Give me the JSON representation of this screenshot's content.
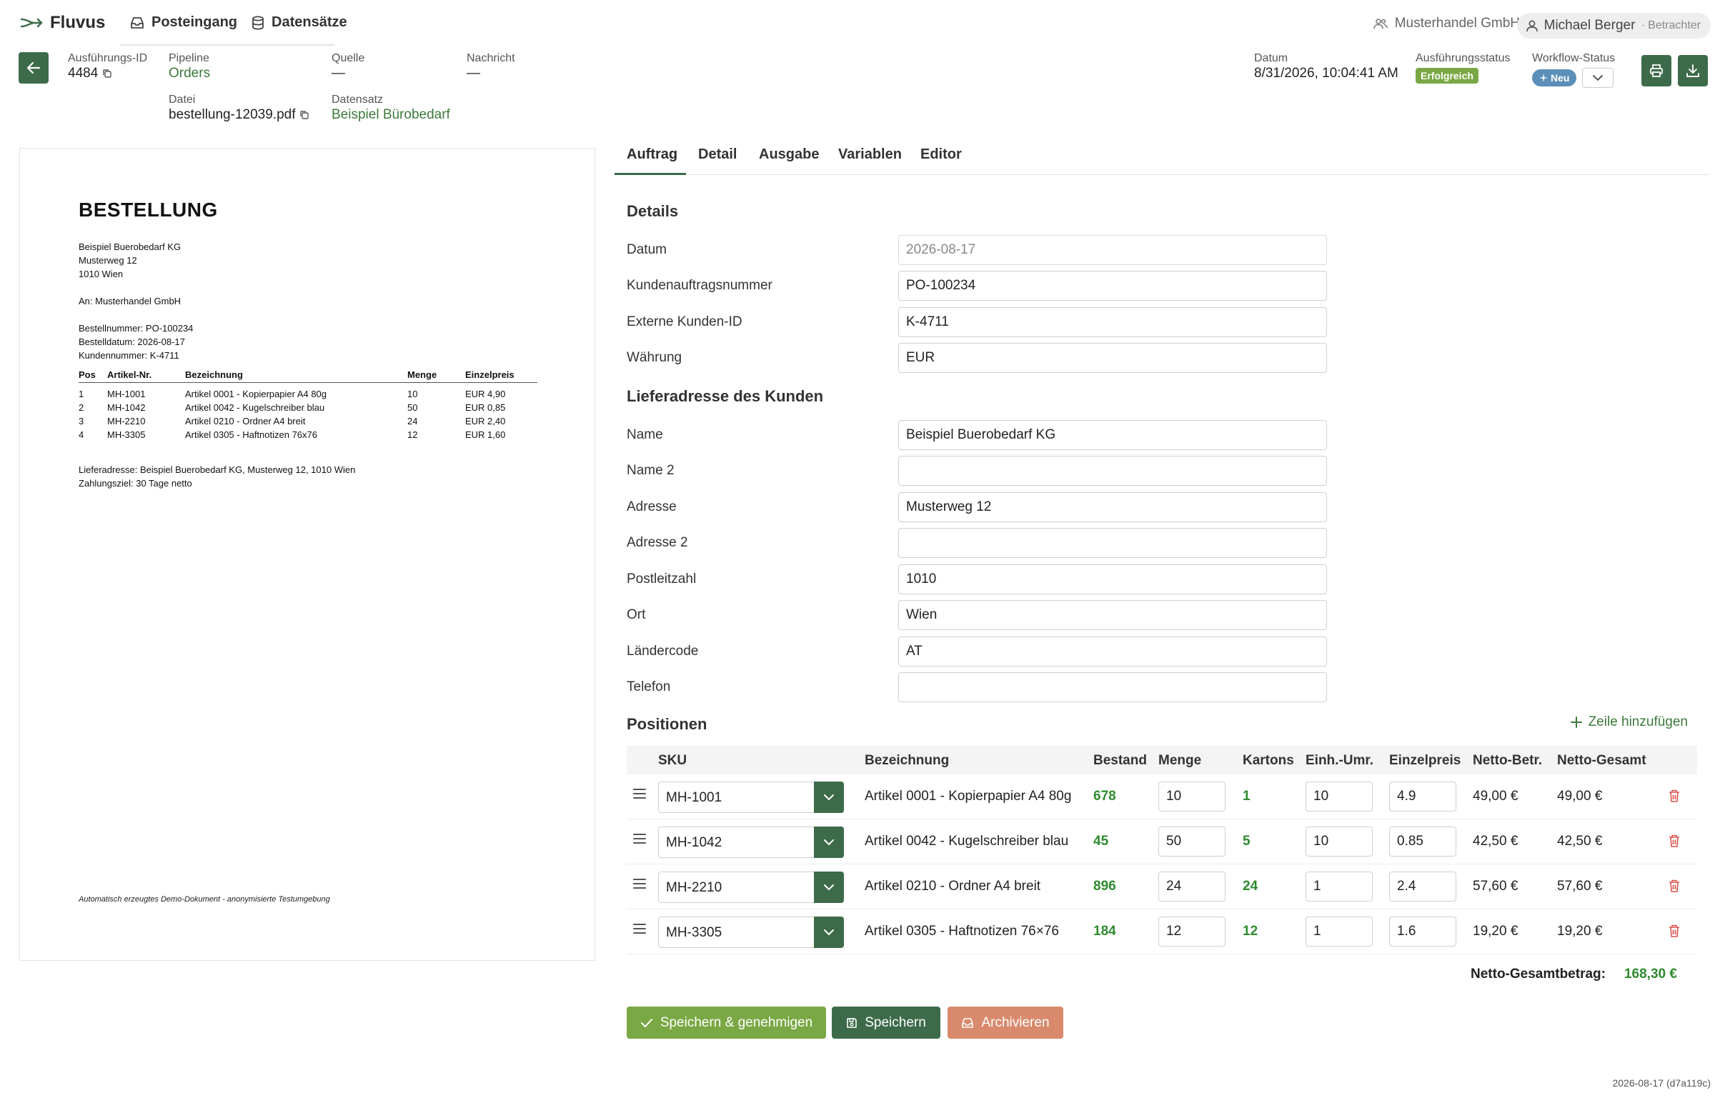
{
  "app": {
    "name": "Fluvus"
  },
  "nav": {
    "inbox": "Posteingang",
    "datasets": "Datensätze"
  },
  "account": {
    "company": "Musterhandel GmbH",
    "user": "Michael Berger",
    "role": "· Betrachter"
  },
  "meta": {
    "run_id_label": "Ausführungs-ID",
    "run_id": "4484",
    "pipeline_label": "Pipeline",
    "pipeline": "Orders",
    "source_label": "Quelle",
    "source": "—",
    "message_label": "Nachricht",
    "message": "—",
    "file_label": "Datei",
    "file": "bestellung-12039.pdf",
    "dataset_label": "Datensatz",
    "dataset": "Beispiel Bürobedarf",
    "date_label": "Datum",
    "date": "8/31/2026, 10:04:41 AM",
    "exec_status_label": "Ausführungsstatus",
    "exec_status": "Erfolgreich",
    "workflow_label": "Workflow-Status",
    "workflow": "Neu"
  },
  "document": {
    "title": "BESTELLUNG",
    "sender": [
      "Beispiel Buerobedarf KG",
      "Musterweg 12",
      "1010 Wien"
    ],
    "recipient": "An: Musterhandel GmbH",
    "order_info": [
      "Bestellnummer: PO-100234",
      "Bestelldatum: 2026-08-17",
      "Kundennummer: K-4711"
    ],
    "columns": [
      "Pos",
      "Artikel-Nr.",
      "Bezeichnung",
      "Menge",
      "Einzelpreis"
    ],
    "rows": [
      [
        "1",
        "MH-1001",
        "Artikel 0001 - Kopierpapier A4 80g",
        "10",
        "EUR 4,90"
      ],
      [
        "2",
        "MH-1042",
        "Artikel 0042 - Kugelschreiber blau",
        "50",
        "EUR 0,85"
      ],
      [
        "3",
        "MH-2210",
        "Artikel 0210 - Ordner A4 breit",
        "24",
        "EUR 2,40"
      ],
      [
        "4",
        "MH-3305",
        "Artikel 0305 - Haftnotizen 76x76",
        "12",
        "EUR 1,60"
      ]
    ],
    "delivery": "Lieferadresse: Beispiel Buerobedarf KG, Musterweg 12, 1010 Wien",
    "payment": "Zahlungsziel: 30 Tage netto",
    "footer": "Automatisch erzeugtes Demo-Dokument - anonymisierte Testumgebung"
  },
  "tabs": [
    "Auftrag",
    "Detail",
    "Ausgabe",
    "Variablen",
    "Editor"
  ],
  "details": {
    "heading": "Details",
    "fields": [
      {
        "label": "Datum",
        "value": "2026-08-17"
      },
      {
        "label": "Kundenauftragsnummer",
        "value": "PO-100234"
      },
      {
        "label": "Externe Kunden-ID",
        "value": "K-4711"
      },
      {
        "label": "Währung",
        "value": "EUR"
      }
    ]
  },
  "address": {
    "heading": "Lieferadresse des Kunden",
    "fields": [
      {
        "label": "Name",
        "value": "Beispiel Buerobedarf KG"
      },
      {
        "label": "Name 2",
        "value": ""
      },
      {
        "label": "Adresse",
        "value": "Musterweg 12"
      },
      {
        "label": "Adresse 2",
        "value": ""
      },
      {
        "label": "Postleitzahl",
        "value": "1010"
      },
      {
        "label": "Ort",
        "value": "Wien"
      },
      {
        "label": "Ländercode",
        "value": "AT"
      },
      {
        "label": "Telefon",
        "value": ""
      }
    ]
  },
  "positions": {
    "heading": "Positionen",
    "add_label": "Zeile hinzufügen",
    "columns": [
      "SKU",
      "Bezeichnung",
      "Bestand",
      "Menge",
      "Kartons",
      "Einh.-Umr.",
      "Einzelpreis",
      "Netto-Betr.",
      "Netto-Gesamt"
    ],
    "rows": [
      {
        "sku": "MH-1001",
        "desc": "Artikel 0001 - Kopierpapier A4 80g",
        "stock": "678",
        "qty": "10",
        "cartons": "1",
        "conv": "10",
        "price": "4.9",
        "net": "49,00 €",
        "net_total": "49,00 €"
      },
      {
        "sku": "MH-1042",
        "desc": "Artikel 0042 - Kugelschreiber blau",
        "stock": "45",
        "qty": "50",
        "cartons": "5",
        "conv": "10",
        "price": "0.85",
        "net": "42,50 €",
        "net_total": "42,50 €"
      },
      {
        "sku": "MH-2210",
        "desc": "Artikel 0210 - Ordner A4 breit",
        "stock": "896",
        "qty": "24",
        "cartons": "24",
        "conv": "1",
        "price": "2.4",
        "net": "57,60 €",
        "net_total": "57,60 €"
      },
      {
        "sku": "MH-3305",
        "desc": "Artikel 0305 - Haftnotizen 76×76",
        "stock": "184",
        "qty": "12",
        "cartons": "12",
        "conv": "1",
        "price": "1.6",
        "net": "19,20 €",
        "net_total": "19,20 €"
      }
    ],
    "total_label": "Netto-Gesamtbetrag:",
    "total_value": "168,30 €"
  },
  "actions": {
    "approve": "Speichern & genehmigen",
    "save": "Speichern",
    "archive": "Archivieren"
  },
  "version": "2026-08-17 (d7a119c)",
  "colors": {
    "primary": "#3d6b4a",
    "accent_green": "#7aa844",
    "link": "#3c7a3c",
    "archive": "#d98a6c",
    "badge_new": "#5b8fb9"
  }
}
